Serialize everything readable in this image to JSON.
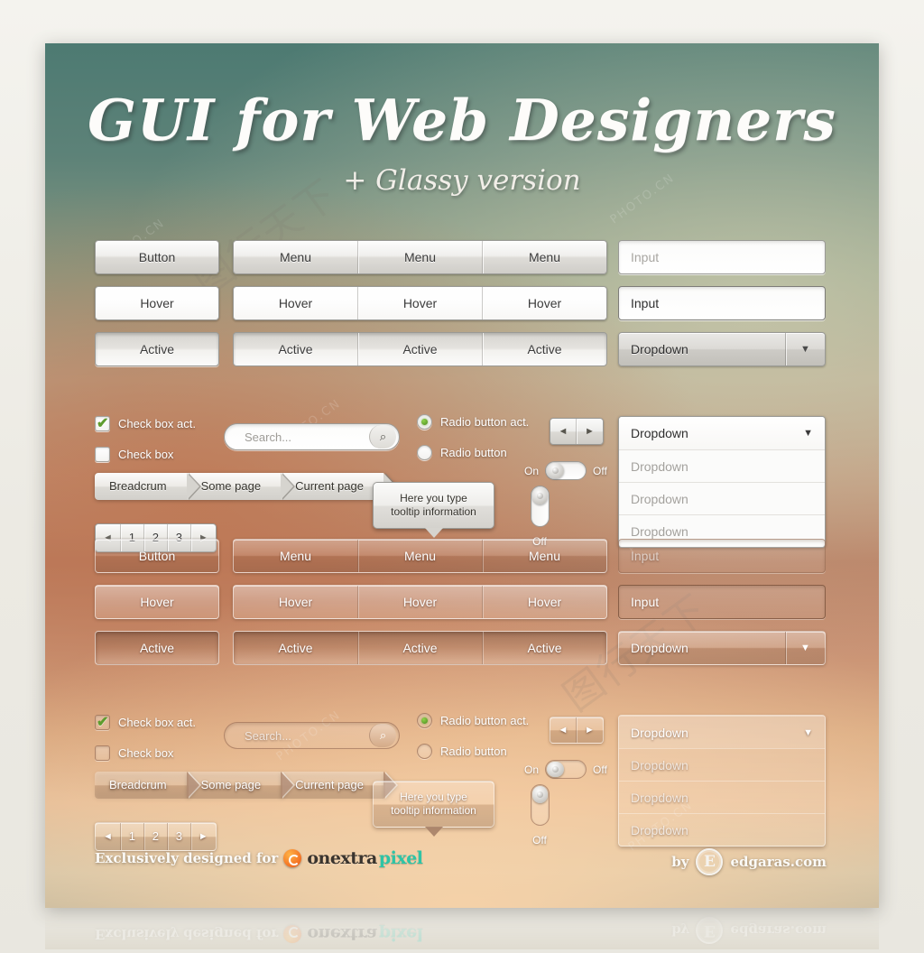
{
  "header": {
    "title": "GUI for Web Designers",
    "subtitle": "+ Glassy version"
  },
  "buttons": {
    "normal": "Button",
    "hover": "Hover",
    "active": "Active"
  },
  "menu": {
    "normal": [
      "Menu",
      "Menu",
      "Menu"
    ],
    "hover": [
      "Hover",
      "Hover",
      "Hover"
    ],
    "active": [
      "Active",
      "Active",
      "Active"
    ]
  },
  "inputs": {
    "placeholder_label": "Input",
    "value_label": "Input"
  },
  "dropdown": {
    "closed_label": "Dropdown",
    "open_head": "Dropdown",
    "open_items": [
      "Dropdown",
      "Dropdown",
      "Dropdown"
    ],
    "arrow_icon": "▼"
  },
  "checkbox": {
    "checked_label": "Check box act.",
    "unchecked_label": "Check box",
    "check_icon": "✔"
  },
  "radio": {
    "checked_label": "Radio button act.",
    "unchecked_label": "Radio button"
  },
  "search": {
    "placeholder": "Search...",
    "icon": "search-icon",
    "icon_glyph": "⌕"
  },
  "breadcrumb": {
    "items": [
      "Breadcrum",
      "Some page",
      "Current page"
    ]
  },
  "pagination": {
    "prev_icon": "◄",
    "next_icon": "►",
    "pages": [
      "1",
      "2",
      "3"
    ]
  },
  "arrow_nav": {
    "prev_icon": "◄",
    "next_icon": "►"
  },
  "toggle": {
    "on_label": "On",
    "off_label": "Off",
    "vertical_label": "Off"
  },
  "tooltip": {
    "line1": "Here you type",
    "line2": "tooltip information"
  },
  "footer": {
    "designed_for": "Exclusively designed for",
    "brand_part1": "onextra",
    "brand_part2": "pixel",
    "by_label": "by",
    "author": "edgaras.com",
    "author_initial": "E"
  },
  "colors": {
    "accent_green": "#5e9c2e",
    "brand_teal": "#2ec4a6",
    "brand_orange": "#f36f21",
    "panel_top": "#4d7a72",
    "panel_mid": "#b8785c",
    "panel_bottom": "#bdb69d"
  },
  "watermarks": {
    "cn_text": "PHOTO.CN",
    "site_text": "图行天下"
  }
}
